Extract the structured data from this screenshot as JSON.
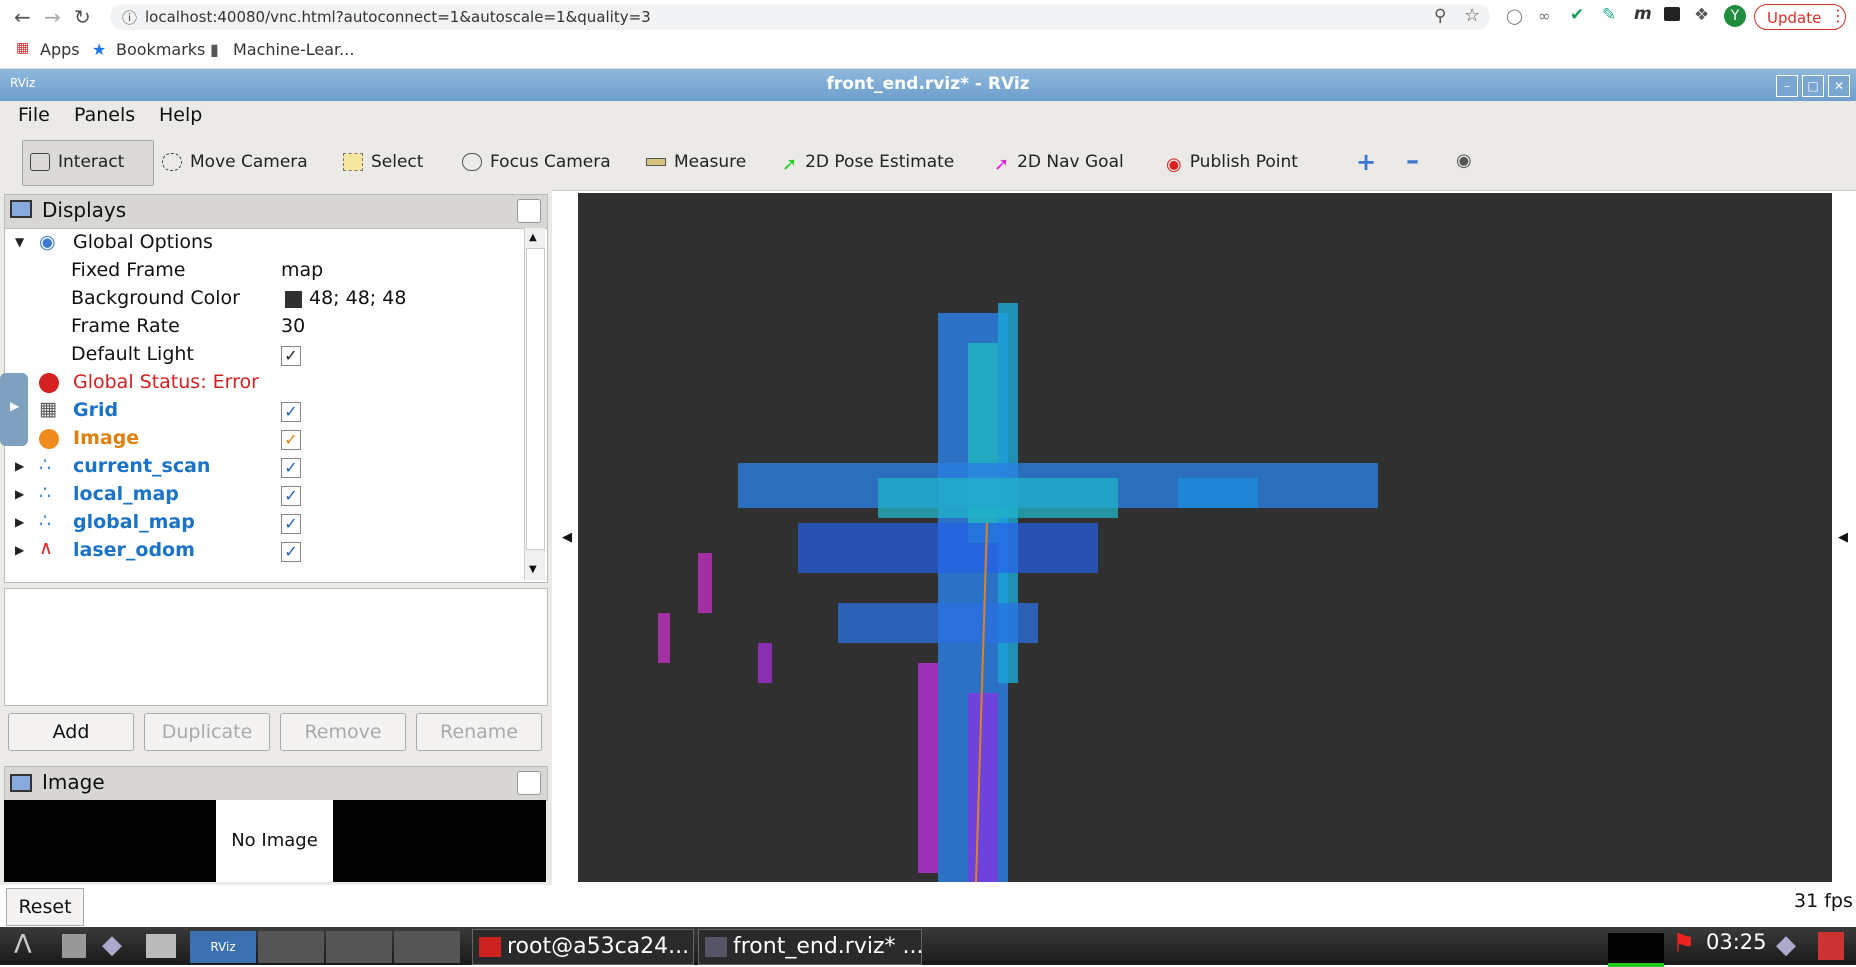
{
  "browser": {
    "url": "localhost:40080/vnc.html?autoconnect=1&autoscale=1&quality=3",
    "update_label": "Update",
    "bookmarks": [
      "Apps",
      "Bookmarks",
      "Machine-Lear..."
    ]
  },
  "window": {
    "title": "front_end.rviz* - RViz"
  },
  "menu": {
    "file": "File",
    "panels": "Panels",
    "help": "Help"
  },
  "toolbar": {
    "interact": "Interact",
    "move_camera": "Move Camera",
    "select": "Select",
    "focus_camera": "Focus Camera",
    "measure": "Measure",
    "pose_estimate": "2D Pose Estimate",
    "nav_goal": "2D Nav Goal",
    "publish_point": "Publish Point"
  },
  "displays": {
    "title": "Displays",
    "global_options": "Global Options",
    "fixed_frame_label": "Fixed Frame",
    "fixed_frame_value": "map",
    "bg_color_label": "Background Color",
    "bg_color_value": "48; 48; 48",
    "frame_rate_label": "Frame Rate",
    "frame_rate_value": "30",
    "default_light_label": "Default Light",
    "global_status": "Global Status: Error",
    "items": [
      "Grid",
      "Image",
      "current_scan",
      "local_map",
      "global_map",
      "laser_odom"
    ]
  },
  "buttons": {
    "add": "Add",
    "duplicate": "Duplicate",
    "remove": "Remove",
    "rename": "Rename",
    "reset": "Reset"
  },
  "image_panel": {
    "title": "Image",
    "no_image": "No Image"
  },
  "status": {
    "fps": "31 fps"
  },
  "taskbar": {
    "terminal": "root@a53ca24...",
    "rviz": "front_end.rviz* ...",
    "clock": "03:25"
  },
  "colors": {
    "accent": "#1a73c8",
    "error": "#d42020",
    "warning": "#e0800e",
    "viewport_bg": "#303030"
  }
}
